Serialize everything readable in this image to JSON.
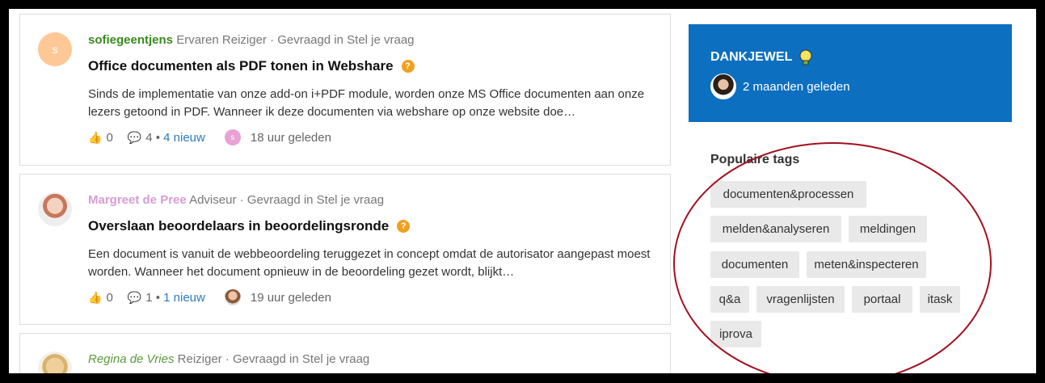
{
  "posts": [
    {
      "avatar_letter": "s",
      "author": "sofiegeentjens",
      "role": "Ervaren Reiziger",
      "sep": "·",
      "asked_in": "Gevraagd in Stel je vraag",
      "title": "Office documenten als PDF tonen in Webshare",
      "excerpt": "Sinds de implementatie van onze add-on i+PDF module, worden onze MS Office documenten aan onze lezers getoond in PDF.  Wanneer ik deze documenten via webshare op onze website doe…",
      "likes": "0",
      "comments": "4",
      "new": "4 nieuw",
      "last_avatar_letter": "s",
      "time": "18 uur geleden"
    },
    {
      "author": "Margreet de Pree",
      "role": "Adviseur",
      "sep": "·",
      "asked_in": "Gevraagd in Stel je vraag",
      "title": "Overslaan beoordelaars in beoordelingsronde",
      "excerpt": "Een document is vanuit de webbeoordeling teruggezet in concept omdat de autorisator aangepast moest worden. Wanneer het document opnieuw in de beoordeling gezet wordt, blijkt…",
      "likes": "0",
      "comments": "1",
      "new": "1 nieuw",
      "time": "19 uur geleden"
    },
    {
      "author": "Regina de Vries",
      "role": "Reiziger",
      "sep": "·",
      "asked_in": "Gevraagd in Stel je vraag"
    }
  ],
  "sidebar": {
    "badge_title": "DANKJEWEL",
    "badge_time": "2 maanden geleden",
    "tags_title": "Populaire tags",
    "tags": [
      "documenten&processen",
      "melden&analyseren",
      "meldingen",
      "documenten",
      "meten&inspecteren",
      "q&a",
      "vragenlijsten",
      "portaal",
      "itask",
      "iprova"
    ]
  },
  "icons": {
    "like": "thumbs-up-icon",
    "comment": "speech-bubble-icon",
    "question": "question-mark-icon",
    "badge": "lightbulb-icon"
  },
  "colors": {
    "accent_blue": "#0c6fc0",
    "question_orange": "#f0a020",
    "annotation_red": "#a31020"
  }
}
